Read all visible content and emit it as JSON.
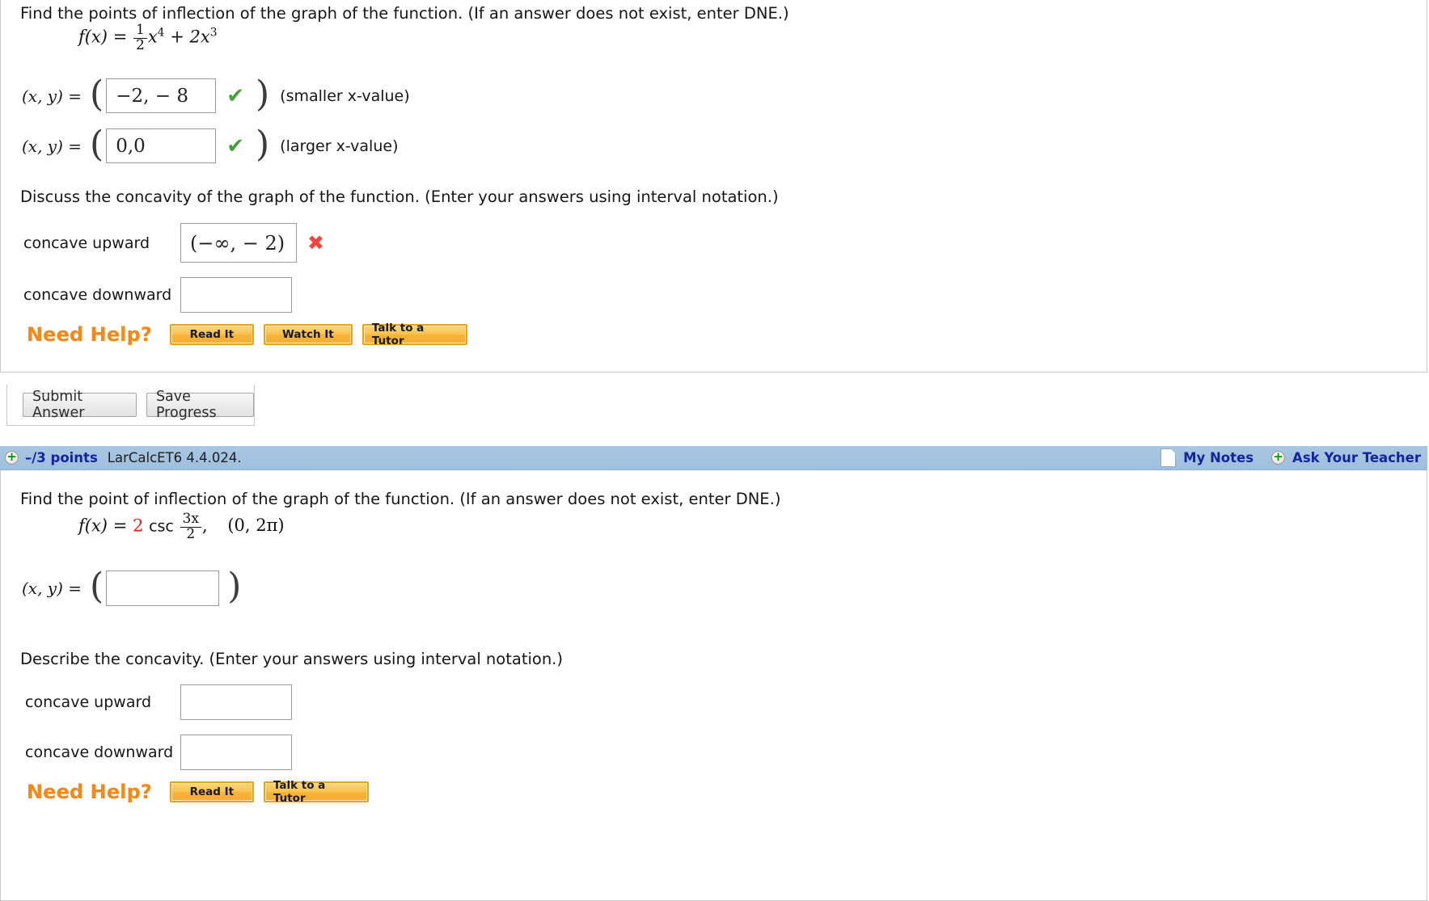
{
  "question1": {
    "prompt": "Find the points of inflection of the graph of the function. (If an answer does not exist, enter DNE.)",
    "formula": {
      "fx": "f(x)",
      "equals": "=",
      "frac_num": "1",
      "frac_den": "2",
      "term1_base": "x",
      "term1_exp": "4",
      "plus": "+",
      "term2": "2x",
      "term2_exp": "3"
    },
    "answers": [
      {
        "label": "(x, y)",
        "equals": "=",
        "value": "−2, − 8",
        "mark": "✔",
        "mark_state": "correct",
        "hint": "(smaller x-value)"
      },
      {
        "label": "(x, y)",
        "equals": "=",
        "value": "0,0",
        "mark": "✔",
        "mark_state": "correct",
        "hint": "(larger x-value)"
      }
    ],
    "concavity_prompt": "Discuss the concavity of the graph of the function. (Enter your answers using interval notation.)",
    "concave_upward_label": "concave upward",
    "concave_upward_value": "(−∞, − 2)",
    "concave_upward_mark": "✖",
    "concave_downward_label": "concave downward",
    "concave_downward_value": "",
    "need_help_title": "Need Help?",
    "help_buttons": [
      "Read It",
      "Watch It",
      "Talk to a Tutor"
    ],
    "submit_label": "Submit Answer",
    "save_label": "Save Progress"
  },
  "question2": {
    "header": {
      "points": "–/3 points",
      "code": "LarCalcET6 4.4.024.",
      "my_notes": "My Notes",
      "ask_teacher": "Ask Your Teacher"
    },
    "prompt": "Find the point of inflection of the graph of the function. (If an answer does not exist, enter DNE.)",
    "formula": {
      "fx": "f(x)",
      "equals": "=",
      "coefficient": "2",
      "func": "csc",
      "frac_num": "3x",
      "frac_den": "2",
      "comma": ",",
      "interval": "(0, 2π)"
    },
    "answer": {
      "label": "(x, y)",
      "equals": "=",
      "value": ""
    },
    "concavity_prompt": "Describe the concavity. (Enter your answers using interval notation.)",
    "concave_upward_label": "concave upward",
    "concave_upward_value": "",
    "concave_downward_label": "concave downward",
    "concave_downward_value": "",
    "need_help_title": "Need Help?",
    "help_buttons": [
      "Read It",
      "Talk to a Tutor"
    ]
  },
  "colors": {
    "accent_orange": "#f08a1c",
    "correct_green": "#4a9e3f",
    "incorrect_red": "#f0453f",
    "header_blue": "#a3c3e0",
    "link_blue": "#14249b",
    "red_coefficient": "#ee1c1c"
  }
}
